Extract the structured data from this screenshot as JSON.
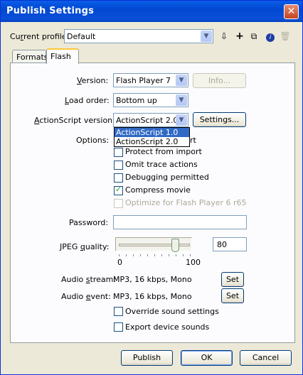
{
  "window": {
    "title": "Publish Settings",
    "close_glyph": "✕"
  },
  "profile": {
    "label_prefix": "Cu",
    "label_u": "r",
    "label_suffix": "rent profile:",
    "value": "Default",
    "icons": [
      "import-export-icon",
      "add-profile-icon",
      "duplicate-profile-icon",
      "profile-info-icon",
      "delete-profile-icon"
    ]
  },
  "tabs": [
    {
      "label": "Formats",
      "active": false
    },
    {
      "label": "Flash",
      "active": true
    }
  ],
  "version": {
    "label_u": "V",
    "label_rest": "ersion:",
    "value": "Flash Player 7",
    "info_button": "Info..."
  },
  "load_order": {
    "label_u": "L",
    "label_rest": "oad order:",
    "value": "Bottom up"
  },
  "actionscript": {
    "label_u": "A",
    "label_rest": "ctionScript version:",
    "value": "ActionScript 2.0",
    "settings_button": "Settings...",
    "options": [
      "ActionScript 1.0",
      "ActionScript 2.0"
    ],
    "highlighted_option": "ActionScript 1.0"
  },
  "options": {
    "label": "Options:",
    "hidden_suffix": "rt",
    "items": [
      {
        "label": "Protect from import",
        "checked": false,
        "enabled": true
      },
      {
        "label": "Omit trace actions",
        "checked": false,
        "enabled": true
      },
      {
        "label": "Debugging permitted",
        "checked": false,
        "enabled": true
      },
      {
        "label": "Compress movie",
        "checked": true,
        "enabled": true
      },
      {
        "label": "Optimize for Flash Player 6 r65",
        "checked": false,
        "enabled": false
      }
    ]
  },
  "password": {
    "label": "Password:",
    "value": ""
  },
  "jpeg": {
    "label_prefix": "JPEG ",
    "label_u": "q",
    "label_rest": "uality:",
    "value": "80",
    "slider_value": 80,
    "min_label": "0",
    "max_label": "100"
  },
  "audio_stream": {
    "label_prefix": "Audio ",
    "label_u": "s",
    "label_rest": "tream:",
    "value": "MP3, 16 kbps, Mono",
    "button": "Set"
  },
  "audio_event": {
    "label_prefix": "Audio ",
    "label_u": "e",
    "label_rest": "vent:",
    "value": "MP3, 16 kbps, Mono",
    "button": "Set"
  },
  "override_sound": {
    "label": "Override sound settings",
    "checked": false
  },
  "export_device_sounds": {
    "label": "Export device sounds",
    "checked": false
  },
  "footer": {
    "publish": "Publish",
    "ok": "OK",
    "cancel": "Cancel"
  },
  "colors": {
    "titlebar": "#0148d1",
    "dialog_bg": "#ece9d8",
    "selection": "#316ac5"
  }
}
